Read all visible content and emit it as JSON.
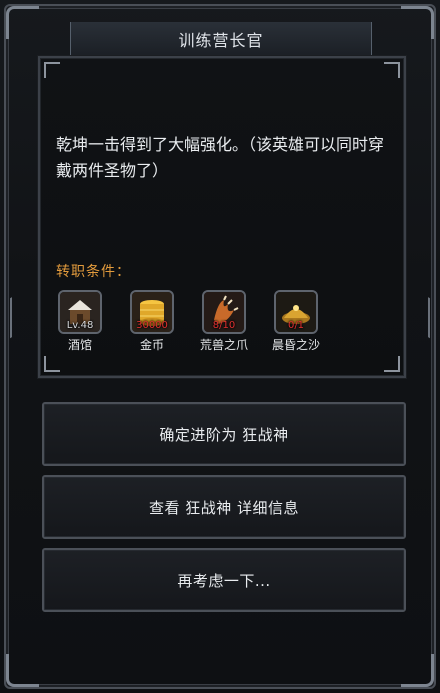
{
  "dialog": {
    "title": "训练营长官",
    "description": "乾坤一击得到了大幅强化。（该英雄可以同时穿戴两件圣物了）",
    "requirements_title": "转职条件：",
    "requirements": [
      {
        "icon": "tavern-icon",
        "count": "Lv.48",
        "count_color": "#d8dadd",
        "label": "酒馆"
      },
      {
        "icon": "gold-coin-icon",
        "count": "30000",
        "count_color": "#e03030",
        "label": "金币"
      },
      {
        "icon": "beast-claw-icon",
        "count": "8/10",
        "count_color": "#e03030",
        "label": "荒兽之爪"
      },
      {
        "icon": "dusk-sand-icon",
        "count": "0/1",
        "count_color": "#e03030",
        "label": "晨昏之沙"
      }
    ]
  },
  "buttons": {
    "confirm_label": "确定进阶为 狂战神",
    "details_label": "查看 狂战神 详细信息",
    "cancel_label": "再考虑一下..."
  },
  "colors": {
    "accent": "#e19a3c",
    "warning": "#e03030",
    "text": "#e9ecef"
  }
}
